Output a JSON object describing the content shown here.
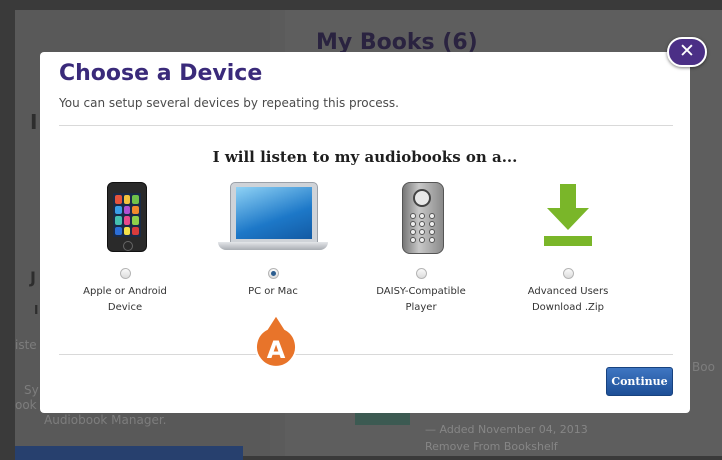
{
  "background": {
    "heading": "My Books (6)",
    "left_text": [
      "I",
      "J",
      "I",
      "iste",
      "Sy",
      "ook",
      "Audiobook Manager."
    ],
    "right_text": [
      "Boo"
    ],
    "book": {
      "added": "— Added November 04, 2013",
      "remove": "Remove From Bookshelf"
    }
  },
  "dialog": {
    "title": "Choose a Device",
    "subtitle": "You can setup several devices by repeating this process.",
    "prompt": "I will listen to my audiobooks on a...",
    "options": [
      {
        "line1": "Apple or Android",
        "line2": "Device",
        "icon": "smartphone-icon",
        "selected": false
      },
      {
        "line1": "PC or Mac",
        "line2": "",
        "icon": "laptop-icon",
        "selected": true
      },
      {
        "line1": "DAISY-Compatible",
        "line2": "Player",
        "icon": "daisy-player-icon",
        "selected": false
      },
      {
        "line1": "Advanced Users",
        "line2": "Download .Zip",
        "icon": "download-arrow-icon",
        "selected": false
      }
    ],
    "continue_label": "Continue",
    "close_glyph": "✕"
  },
  "callout": {
    "letter": "A",
    "color": "#e8742a"
  },
  "colors": {
    "title": "#3a2a7a",
    "button": "#2a5fa8",
    "close": "#4b2f86",
    "download_green": "#7ab629"
  }
}
